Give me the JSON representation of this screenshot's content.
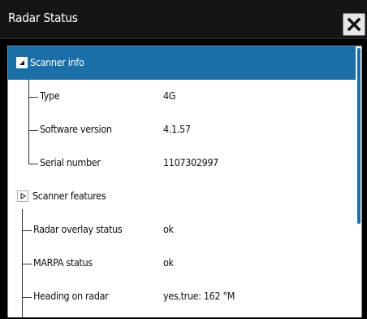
{
  "window": {
    "title": "Radar Status"
  },
  "tree": {
    "scanner_info": {
      "label": "Scanner info",
      "expanded": true
    },
    "type": {
      "label": "Type",
      "value": "4G"
    },
    "software_version": {
      "label": "Software version",
      "value": "4.1.57"
    },
    "serial_number": {
      "label": "Serial number",
      "value": "1107302997"
    },
    "scanner_features": {
      "label": "Scanner features",
      "expanded": false
    },
    "radar_overlay_status": {
      "label": "Radar overlay status",
      "value": "ok"
    },
    "marpa_status": {
      "label": "MARPA status",
      "value": "ok"
    },
    "heading_on_radar": {
      "label": "Heading on radar",
      "value": "yes,true: 162 °M"
    }
  },
  "colors": {
    "accent": "#1b6fa8",
    "panel_bg": "#ffffff",
    "window_bg": "#000000"
  },
  "icons": {
    "close": "close-icon",
    "expanded": "triangle-down-icon",
    "collapsed": "triangle-right-icon"
  }
}
